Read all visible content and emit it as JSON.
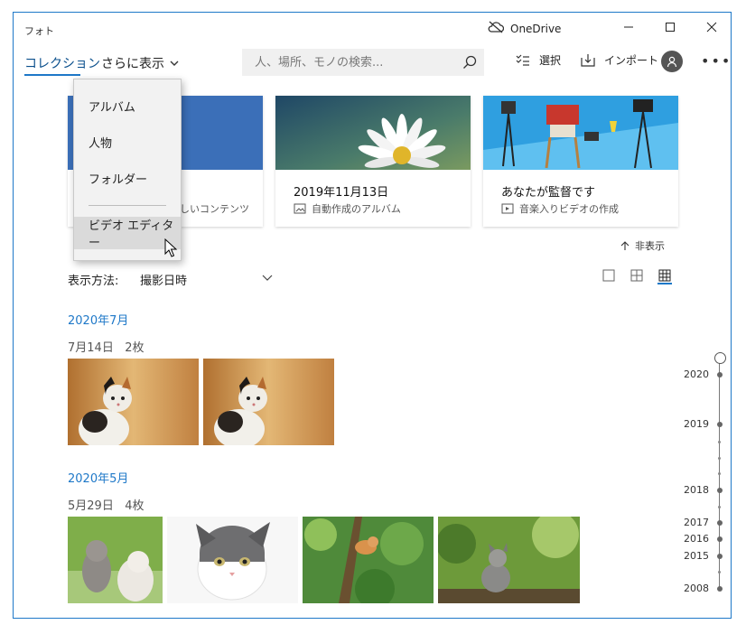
{
  "window": {
    "title": "フォト",
    "onedrive_label": "OneDrive"
  },
  "nav": {
    "collection": "コレクション",
    "more": "さらに表示"
  },
  "search": {
    "placeholder": "人、場所、モノの検索..."
  },
  "commands": {
    "select": "選択",
    "import": "インポート"
  },
  "dropdown": {
    "items": [
      "アルバム",
      "人物",
      "フォルダー",
      "ビデオ エディター"
    ]
  },
  "cards": [
    {
      "title": "",
      "subtitle": "しいコンテンツ"
    },
    {
      "title": "2019年11月13日",
      "subtitle": "自動作成のアルバム"
    },
    {
      "title": "あなたが監督です",
      "subtitle": "音楽入りビデオの作成"
    }
  ],
  "hide_label": "非表示",
  "sort": {
    "label": "表示方法:",
    "value": "撮影日時"
  },
  "groups": [
    {
      "month": "2020年7月",
      "day": "7月14日",
      "count": "2枚"
    },
    {
      "month": "2020年5月",
      "day": "5月29日",
      "count": "4枚"
    }
  ],
  "timeline": [
    "2020",
    "2019",
    "2018",
    "2017",
    "2016",
    "2015",
    "2008"
  ],
  "colors": {
    "accent": "#1e78c8",
    "month_text": "#1e78c8"
  }
}
